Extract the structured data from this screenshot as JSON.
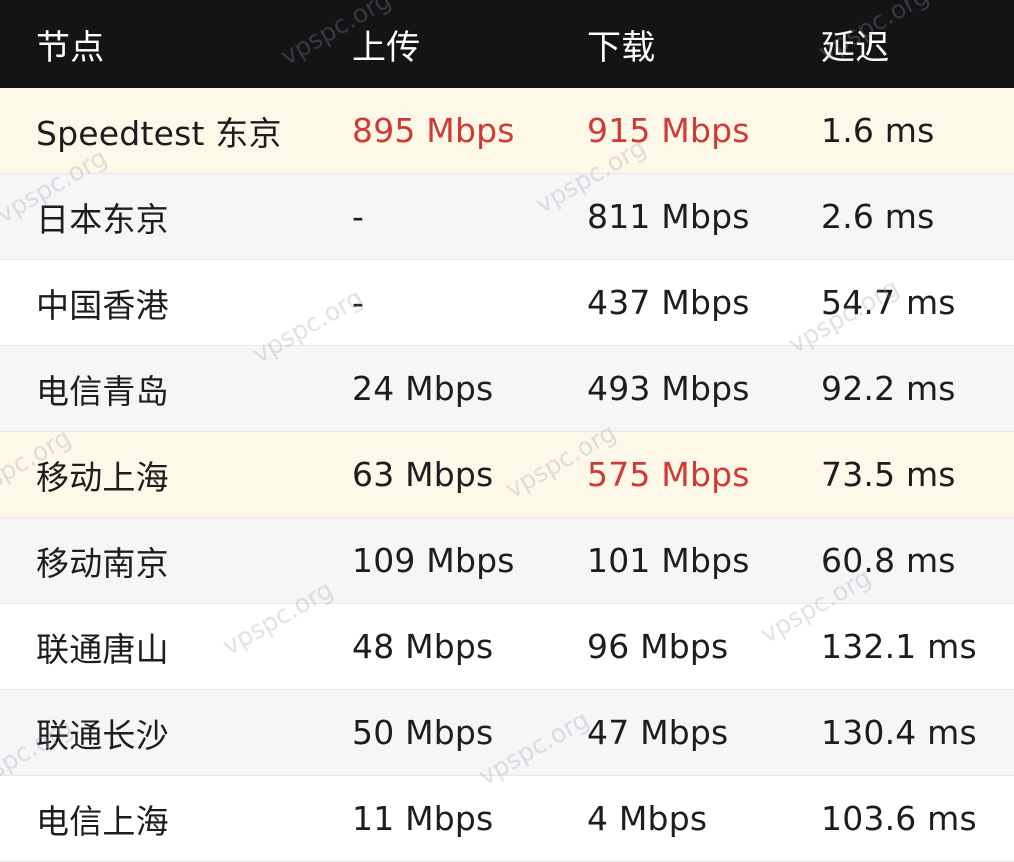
{
  "columns": [
    "节点",
    "上传",
    "下载",
    "延迟"
  ],
  "rows": [
    {
      "node": "Speedtest 东京",
      "upload": "895 Mbps",
      "download": "915 Mbps",
      "latency": "1.6 ms",
      "row_highlight": true,
      "upload_highlight": true,
      "download_highlight": true
    },
    {
      "node": "日本东京",
      "upload": "-",
      "download": "811 Mbps",
      "latency": "2.6 ms",
      "row_highlight": false,
      "upload_highlight": false,
      "download_highlight": false
    },
    {
      "node": "中国香港",
      "upload": "-",
      "download": "437 Mbps",
      "latency": "54.7 ms",
      "row_highlight": false,
      "upload_highlight": false,
      "download_highlight": false
    },
    {
      "node": "电信青岛",
      "upload": "24 Mbps",
      "download": "493 Mbps",
      "latency": "92.2 ms",
      "row_highlight": false,
      "upload_highlight": false,
      "download_highlight": false
    },
    {
      "node": "移动上海",
      "upload": "63 Mbps",
      "download": "575 Mbps",
      "latency": "73.5 ms",
      "row_highlight": true,
      "upload_highlight": false,
      "download_highlight": true
    },
    {
      "node": "移动南京",
      "upload": "109 Mbps",
      "download": "101 Mbps",
      "latency": "60.8 ms",
      "row_highlight": false,
      "upload_highlight": false,
      "download_highlight": false
    },
    {
      "node": "联通唐山",
      "upload": "48 Mbps",
      "download": "96 Mbps",
      "latency": "132.1 ms",
      "row_highlight": false,
      "upload_highlight": false,
      "download_highlight": false
    },
    {
      "node": "联通长沙",
      "upload": "50 Mbps",
      "download": "47 Mbps",
      "latency": "130.4 ms",
      "row_highlight": false,
      "upload_highlight": false,
      "download_highlight": false
    },
    {
      "node": "电信上海",
      "upload": "11 Mbps",
      "download": "4 Mbps",
      "latency": "103.6 ms",
      "row_highlight": false,
      "upload_highlight": false,
      "download_highlight": false
    }
  ],
  "watermark": "vpspc.org",
  "colors": {
    "header_bg": "#141417",
    "header_text": "#ffffff",
    "highlight_row_bg": "#fdf8e8",
    "alt_row_bg": "#f6f6f8",
    "highlight_value": "#d03a34",
    "text": "#1d1d1f"
  }
}
